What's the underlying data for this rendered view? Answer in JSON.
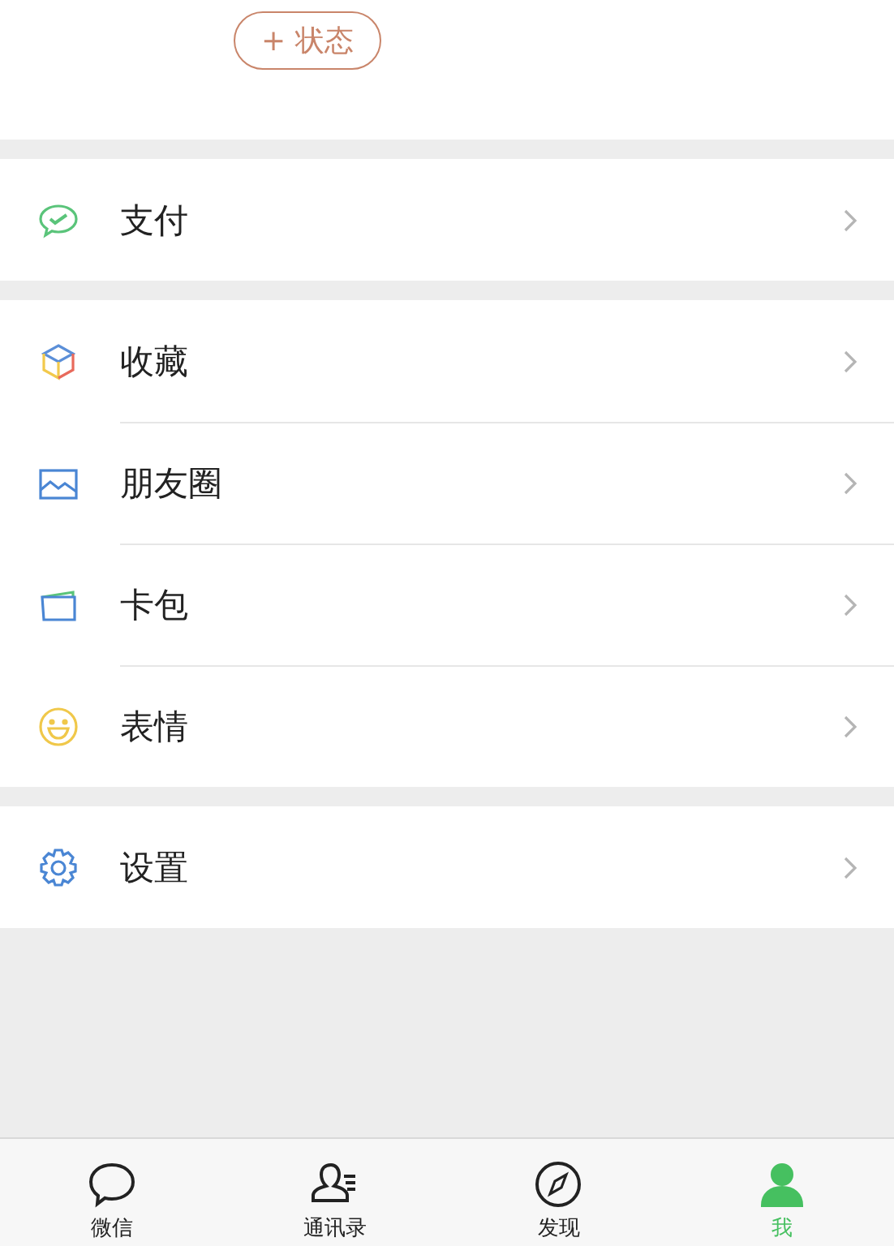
{
  "status_button": {
    "label": "+ 状态"
  },
  "groups": [
    {
      "items": [
        {
          "label": "支付",
          "kind": "pay"
        }
      ]
    },
    {
      "items": [
        {
          "label": "收藏",
          "kind": "favorites"
        },
        {
          "label": "朋友圈",
          "kind": "moments"
        },
        {
          "label": "卡包",
          "kind": "wallet"
        },
        {
          "label": "表情",
          "kind": "stickers"
        }
      ]
    },
    {
      "items": [
        {
          "label": "设置",
          "kind": "settings"
        }
      ]
    }
  ],
  "tab_bar": [
    {
      "label": "微信",
      "kind": "chats",
      "selected": false
    },
    {
      "label": "通讯录",
      "kind": "contacts",
      "selected": false
    },
    {
      "label": "发现",
      "kind": "discover",
      "selected": false
    },
    {
      "label": "我",
      "kind": "me",
      "selected": true
    }
  ]
}
